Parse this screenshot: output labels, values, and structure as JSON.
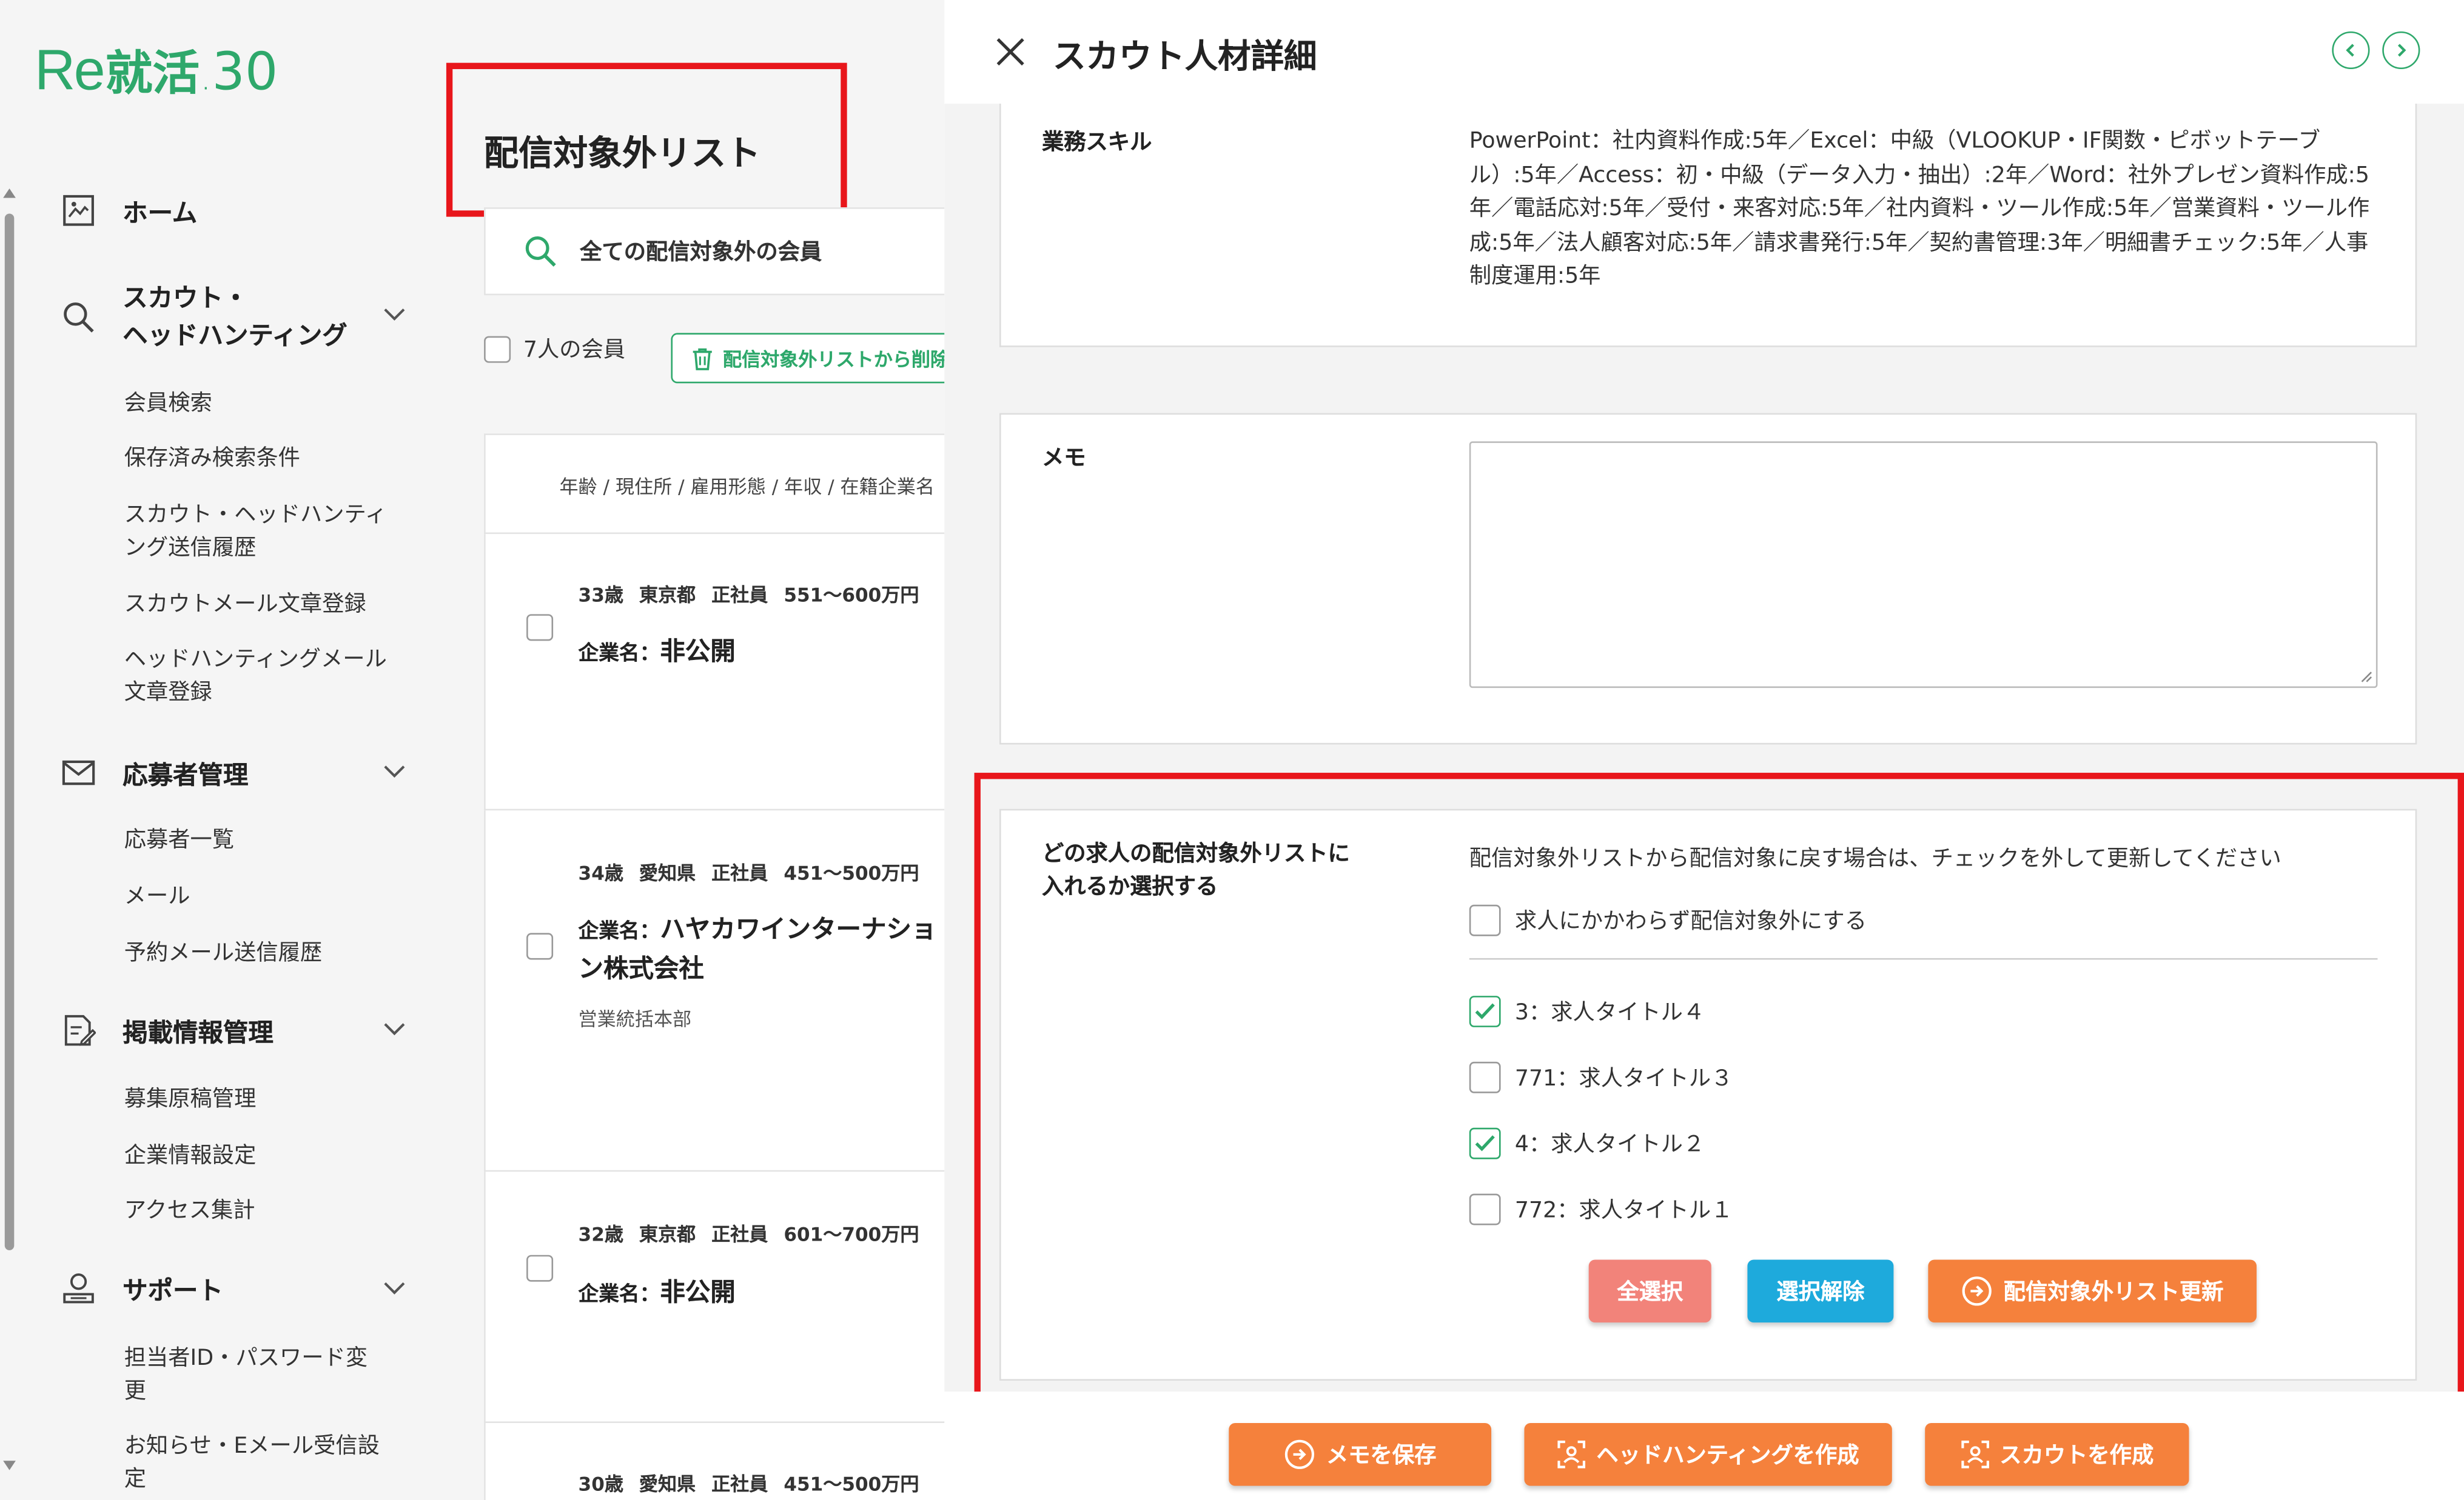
{
  "brand": {
    "logo_re": "Re",
    "logo_main": "就活",
    "logo_dot": ".",
    "logo_num": "30"
  },
  "colors": {
    "brand_green": "#2ea86b",
    "orange": "#f5813c",
    "salmon": "#f2837a",
    "sky": "#1eaadc",
    "highlight_red": "#e8161b"
  },
  "sidebar": {
    "home": "ホーム",
    "scout": {
      "label_line1": "スカウト・",
      "label_line2": "ヘッドハンティング",
      "items": [
        "会員検索",
        "保存済み検索条件",
        "スカウト・ヘッドハンティング送信履歴",
        "スカウトメール文章登録",
        "ヘッドハンティングメール文章登録"
      ]
    },
    "applicant": {
      "label": "応募者管理",
      "items": [
        "応募者一覧",
        "メール",
        "予約メール送信履歴"
      ]
    },
    "listing": {
      "label": "掲載情報管理",
      "items": [
        "募集原稿管理",
        "企業情報設定",
        "アクセス集計"
      ]
    },
    "support": {
      "label": "サポート",
      "items": [
        "担当者ID・パスワード変更",
        "お知らせ・Eメール受信設定"
      ]
    }
  },
  "list_panel": {
    "title": "配信対象外リスト",
    "search_label": "全ての配信対象外の会員",
    "count_label": "7人の会員",
    "remove_button": "配信対象外リストから削除",
    "column_header": "年齢 / 現住所 / 雇用形態 / 年収 / 在籍企業名",
    "members": [
      {
        "age": "33歳",
        "pref": "東京都",
        "type": "正社員",
        "salary": "551〜600万円",
        "company_label": "企業名：",
        "company": "非公開",
        "dept": ""
      },
      {
        "age": "34歳",
        "pref": "愛知県",
        "type": "正社員",
        "salary": "451〜500万円",
        "company_label": "企業名：",
        "company": "ハヤカワインターナショ ン株式会社",
        "dept": "営業統括本部"
      },
      {
        "age": "32歳",
        "pref": "東京都",
        "type": "正社員",
        "salary": "601〜700万円",
        "company_label": "企業名：",
        "company": "非公開",
        "dept": ""
      },
      {
        "age": "30歳",
        "pref": "愛知県",
        "type": "正社員",
        "salary": "451〜500万円",
        "company_label": "",
        "company": "",
        "dept": ""
      }
    ]
  },
  "detail": {
    "title": "スカウト人材詳細",
    "skills_label": "業務スキル",
    "skills_text": "PowerPoint：社内資料作成:5年／Excel：中級（VLOOKUP・IF関数・ピボットテーブル）:5年／Access：初・中級（データ入力・抽出）:2年／Word：社外プレゼン資料作成:5年／電話応対:5年／受付・来客対応:5年／社内資料・ツール作成:5年／営業資料・ツール作成:5年／法人顧客対応:5年／請求書発行:5年／契約書管理:3年／明細書チェック:5年／人事制度運用:5年",
    "memo_label": "メモ",
    "memo_value": "",
    "select_label_line1": "どの求人の配信対象外リストに",
    "select_label_line2": "入れるか選択する",
    "select_note": "配信対象外リストから配信対象に戻す場合は、チェックを外して更新してください",
    "all_jobs_option": "求人にかかわらず配信対象外にする",
    "jobs": [
      {
        "label": "3：求人タイトル４",
        "checked": true
      },
      {
        "label": "771：求人タイトル３",
        "checked": false
      },
      {
        "label": "4：求人タイトル２",
        "checked": true
      },
      {
        "label": "772：求人タイトル１",
        "checked": false
      }
    ],
    "btn_select_all": "全選択",
    "btn_clear": "選択解除",
    "btn_update": "配信対象外リスト更新",
    "btn_save_memo": "メモを保存",
    "btn_headhunt": "ヘッドハンティングを作成",
    "btn_scout": "スカウトを作成"
  }
}
